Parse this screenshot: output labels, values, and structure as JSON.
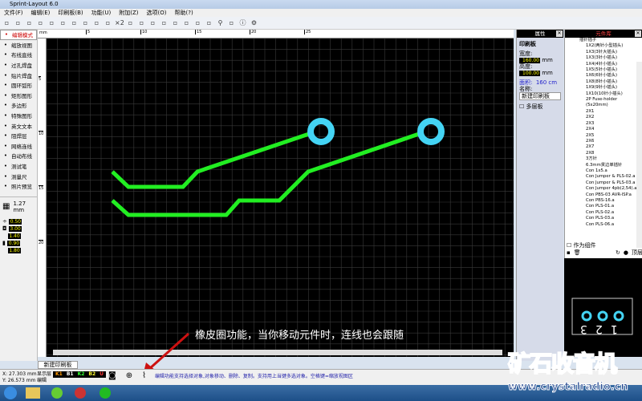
{
  "app": {
    "title": "Sprint-Layout 6.0"
  },
  "menu": [
    "文件(F)",
    "编辑(E)",
    "印刷板(B)",
    "功能(U)",
    "附加(Z)",
    "选项(O)",
    "帮助(?)"
  ],
  "toolbar_zoom_label": "×2",
  "tools": [
    {
      "icon": "pointer-icon",
      "label": "编辑模式"
    },
    {
      "icon": "zoom-icon",
      "label": "缩放视图"
    },
    {
      "icon": "track-icon",
      "label": "布线直线"
    },
    {
      "icon": "via-pad-icon",
      "label": "过孔焊盘"
    },
    {
      "icon": "smd-pad-icon",
      "label": "贴片焊盘"
    },
    {
      "icon": "circle-icon",
      "label": "圆环弧形"
    },
    {
      "icon": "rectangle-icon",
      "label": "矩形图形"
    },
    {
      "icon": "polygon-icon",
      "label": "多边形"
    },
    {
      "icon": "special-shape-icon",
      "label": "特殊图形"
    },
    {
      "icon": "text-icon",
      "label": "英文文本"
    },
    {
      "icon": "solder-mask-icon",
      "label": "阻焊层"
    },
    {
      "icon": "connection-icon",
      "label": "网络连线"
    },
    {
      "icon": "autoroute-icon",
      "label": "自动布线"
    },
    {
      "icon": "test-pen-icon",
      "label": "测试笔"
    },
    {
      "icon": "measure-icon",
      "label": "测量尺"
    },
    {
      "icon": "photo-preview-icon",
      "label": "照片预览"
    }
  ],
  "grid": "1.27 mm",
  "values": {
    "track_width": "0.50",
    "pad_outer": "3.00",
    "pad_inner": "1.40",
    "smd_w": "0.90",
    "smd_h": "1.80"
  },
  "ruler": {
    "unit": "mm",
    "top": [
      "5",
      "10",
      "15",
      "20",
      "25"
    ],
    "left": [
      "5",
      "10",
      "15",
      "20"
    ]
  },
  "annotation": "橡皮圈功能，当你移动元件时，连线也会跟随",
  "colors": {
    "track": "#22ee22",
    "pad": "#44d4f4",
    "annotation_arrow": "#cc1111"
  },
  "properties": {
    "header": "属性",
    "section": "印刷板",
    "width_label": "宽度:",
    "width": "160.00",
    "height_label": "高度:",
    "height": "100.00",
    "unit": "mm",
    "area_label": "面积:",
    "area": "160 cm",
    "name_label": "名称:",
    "name": "新建印刷板",
    "multilayer": "多层板"
  },
  "components": {
    "header": "元件库",
    "root": "插针插子",
    "items": [
      "1X2(两针小型插头)",
      "1X3(3针大插头)",
      "1X3(3针小插头)",
      "1X4(4针小插头)",
      "1X5(5针小插头)",
      "1X6(6针小插头)",
      "1X8(8针小插头)",
      "1X9(9针小插头)",
      "1X10(10针小插头)",
      "2P Fuse-holder (5x20mm)",
      "2X1",
      "2X2",
      "2X3",
      "2X4",
      "2X5",
      "2X6",
      "2X7",
      "2X8",
      "3方针",
      "6.3mm贯边单插针",
      "Con 1x5.a",
      "Con Jumper & PLS-02.a",
      "Con Jumper & PLS-03.a",
      "Con Jumper 4pb(2,54).a",
      "Con PBS-03 AVR-ISP.a",
      "Con PBS-16.a",
      "Con PLS-01.a",
      "Con PLS-02.a",
      "Con PLS-03.a",
      "Con PLS-06.a"
    ],
    "as_component": "作为组件",
    "rotate_label": "顶层"
  },
  "preview_labels": [
    "3",
    "2",
    "1"
  ],
  "tab": "新建印刷板",
  "status": {
    "x": "27.303 mm",
    "y": "26.573 mm",
    "layer_label": "显示层",
    "edit_label": "编辑",
    "layers": [
      "K1",
      "B1",
      "K2",
      "B2",
      "U"
    ],
    "hint": "编辑功能支持选择对象,对象移动、删除、复制。支持用上当键多选对象。空格键=缩放视图区"
  },
  "watermark": {
    "title": "矿石收音机",
    "url": "www.crystalradio.cn"
  }
}
